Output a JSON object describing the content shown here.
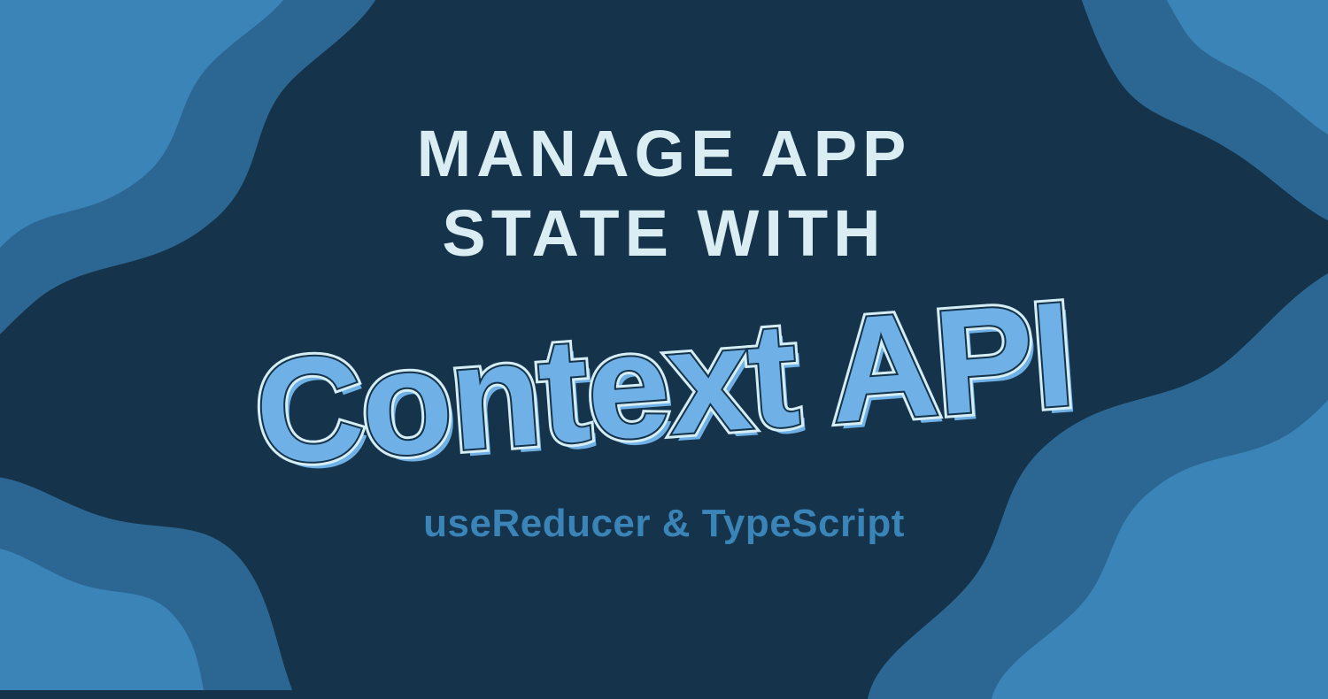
{
  "hero": {
    "line1": "MANAGE APP",
    "line2": "STATE WITH",
    "headline": "Context API",
    "subtitle": "useReducer & TypeScript"
  },
  "colors": {
    "bg_dark": "#15334a",
    "blob_mid": "#2c6793",
    "blob_light": "#3a84b8",
    "text_light": "#d9edf2",
    "accent": "#6fb1e6"
  }
}
